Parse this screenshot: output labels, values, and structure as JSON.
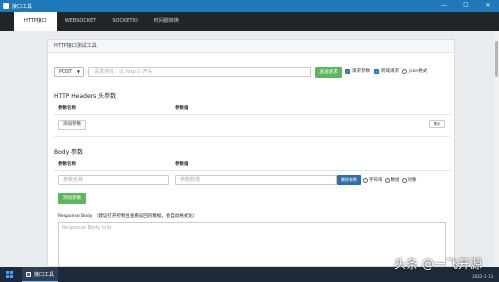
{
  "window": {
    "title": "接口工具",
    "controls": [
      "—",
      "☐",
      "✕"
    ]
  },
  "tabs": [
    {
      "label": "HTTP接口",
      "active": true
    },
    {
      "label": "WEBSOCKET",
      "active": false
    },
    {
      "label": "SOCKETIO",
      "active": false
    },
    {
      "label": "时间戳转换",
      "active": false
    }
  ],
  "card": {
    "header": "HTTP接口测试工具"
  },
  "request": {
    "method": "POST",
    "url_placeholder": "请求地址，以 http:// 开头",
    "send_label": "发送请求",
    "options": [
      {
        "label": "请求参数",
        "type": "checkbox",
        "checked": true
      },
      {
        "label": "跨域请求",
        "type": "checkbox",
        "checked": true
      },
      {
        "label": "json格式",
        "type": "radio",
        "checked": false
      }
    ]
  },
  "headers": {
    "title": "HTTP Headers 头参数",
    "col_name": "参数名称",
    "col_value": "参数值",
    "add_label": "添加参数",
    "tip_label": "提示"
  },
  "body": {
    "title": "Body 参数",
    "col_name": "参数名称",
    "col_value": "参数值",
    "name_placeholder": "参数名称",
    "value_placeholder": "参数数值",
    "action_label": "删除参数",
    "types": [
      "字符串",
      "数组",
      "对象"
    ],
    "add_label": "添加参数"
  },
  "response": {
    "label": "Response Body （建议打开控制台查看返回的数据，会自动格式化）",
    "placeholder": "Response Body Info"
  },
  "taskbar": {
    "app_label": "接口工具",
    "date": "2022-1-13"
  },
  "watermark": "头条 @一飞开源",
  "colors": {
    "titlebar": "#1f78b8",
    "tabbar": "#212529",
    "green": "#5cb85c",
    "blue": "#2f6fb0"
  }
}
